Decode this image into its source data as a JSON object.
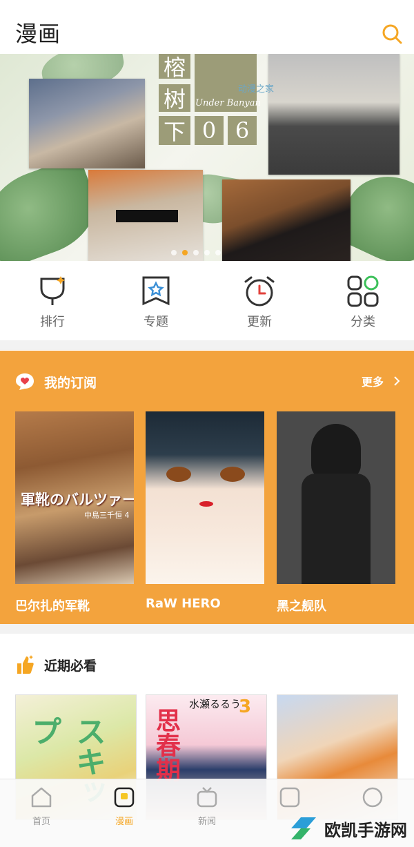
{
  "header": {
    "title": "漫画"
  },
  "banner": {
    "tile_chars": [
      "榕",
      "树",
      "下",
      "0",
      "6"
    ],
    "subtitle": "Under Banyan",
    "watermark": "动漫之家",
    "dots_total": 5,
    "dots_active_index": 1
  },
  "quick_nav": [
    {
      "label": "排行",
      "icon": "trophy-icon"
    },
    {
      "label": "专题",
      "icon": "bookmark-star-icon"
    },
    {
      "label": "更新",
      "icon": "alarm-clock-icon"
    },
    {
      "label": "分类",
      "icon": "grid-category-icon"
    }
  ],
  "subscriptions": {
    "title": "我的订阅",
    "more_label": "更多",
    "items": [
      {
        "title": "巴尔扎的军靴",
        "cover_text": "軍靴のバルツァー",
        "cover_sub": "中島三千恒 4"
      },
      {
        "title": "RaW HERO"
      },
      {
        "title": "黑之舰队"
      }
    ]
  },
  "recent": {
    "title": "近期必看",
    "items": [
      {
        "cover_text": "スキップ"
      },
      {
        "cover_text": "思春期",
        "author": "水瀬るるう",
        "badge": "3"
      },
      {
        "cover_text": ""
      }
    ]
  },
  "tabbar": {
    "items": [
      {
        "label": "首页"
      },
      {
        "label": "漫画"
      },
      {
        "label": "新闻"
      },
      {
        "label": ""
      },
      {
        "label": ""
      }
    ],
    "active_index": 1
  },
  "watermark_footer": "欧凯手游网",
  "colors": {
    "accent": "#f5a623",
    "subscription_bg": "#f3a33d"
  }
}
